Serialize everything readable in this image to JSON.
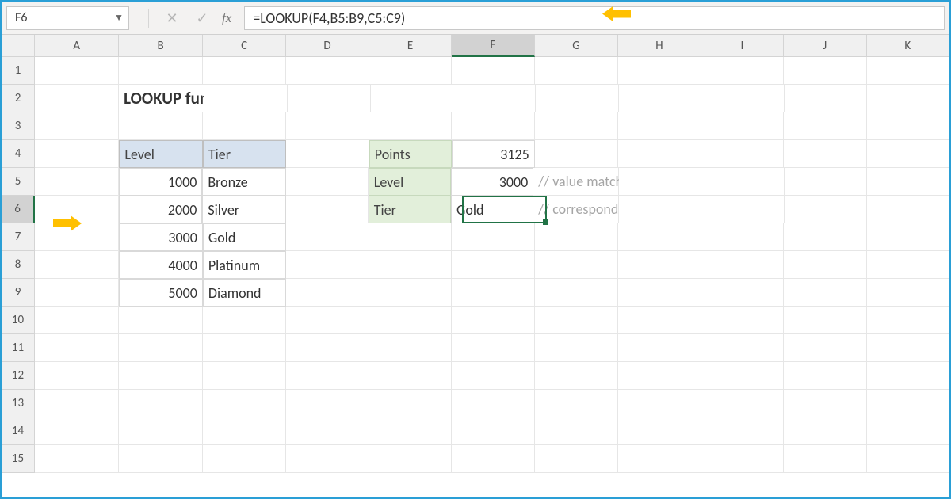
{
  "formula_bar": {
    "cell_ref": "F6",
    "formula": "=LOOKUP(F4,B5:B9,C5:C9)"
  },
  "columns": [
    "A",
    "B",
    "C",
    "D",
    "E",
    "F",
    "G",
    "H",
    "I",
    "J",
    "K"
  ],
  "title": "LOOKUP function",
  "table": {
    "headers": {
      "level": "Level",
      "tier": "Tier"
    },
    "rows": [
      {
        "level": 1000,
        "tier": "Bronze"
      },
      {
        "level": 2000,
        "tier": "Silver"
      },
      {
        "level": 3000,
        "tier": "Gold"
      },
      {
        "level": 4000,
        "tier": "Platinum"
      },
      {
        "level": 5000,
        "tier": "Diamond"
      }
    ]
  },
  "lookup_box": {
    "points_label": "Points",
    "points_value": 3125,
    "level_label": "Level",
    "level_value": 3000,
    "tier_label": "Tier",
    "tier_value": "Gold"
  },
  "comments": {
    "level": "// value matched in level",
    "tier": "// corresponding value in tier"
  },
  "active_cell": "F6"
}
